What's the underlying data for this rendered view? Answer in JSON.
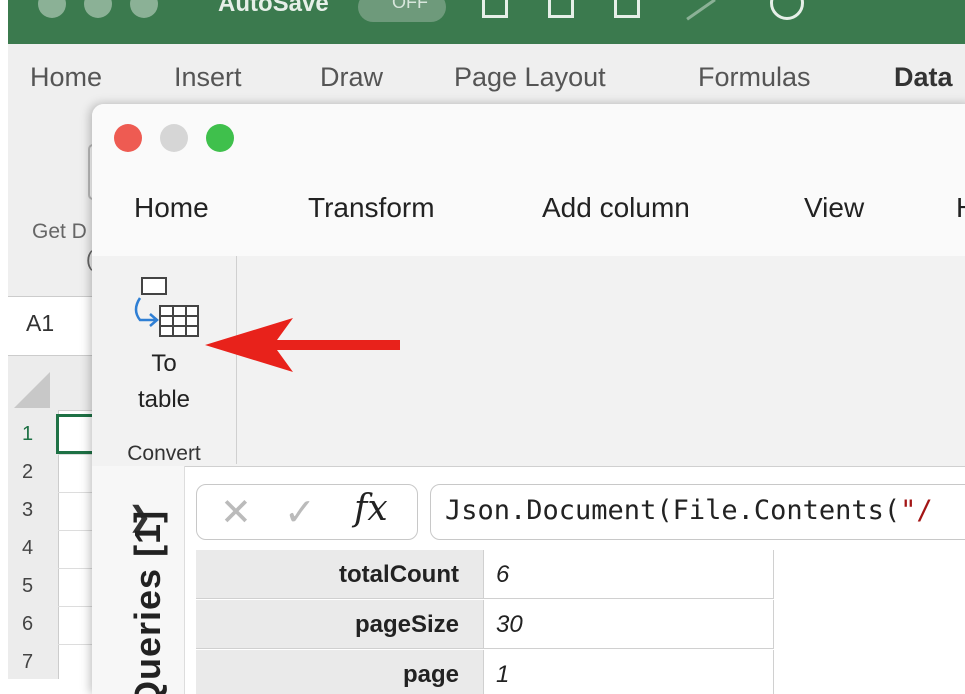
{
  "excel": {
    "title_bar": {
      "autosave_label": "AutoSave",
      "autosave_state": "OFF"
    },
    "tabs": [
      "Home",
      "Insert",
      "Draw",
      "Page Layout",
      "Formulas",
      "Data"
    ],
    "ribbon": {
      "get_data_line1": "Get D",
      "get_data_line2": "("
    },
    "name_box": "A1",
    "row_numbers": [
      "1",
      "2",
      "3",
      "4",
      "5",
      "6",
      "7"
    ],
    "accent_color": "#3b7a4e"
  },
  "power_query": {
    "tabs": [
      "Home",
      "Transform",
      "Add column",
      "View",
      "H"
    ],
    "ribbon": {
      "to_table_line1": "To",
      "to_table_line2": "table",
      "group_label": "Convert",
      "to_table_icon": "to-table-icon"
    },
    "queries_pane": {
      "expand_icon": "chevron-right-icon",
      "label": "Queries [1]"
    },
    "formula_bar": {
      "cancel_icon": "cross-icon",
      "commit_icon": "check-icon",
      "fx_label": "fx",
      "formula_prefix": "Json.Document(File.Contents(",
      "formula_string": "\"/"
    },
    "record": [
      {
        "key": "totalCount",
        "value": "6"
      },
      {
        "key": "pageSize",
        "value": "30"
      },
      {
        "key": "page",
        "value": "1"
      }
    ]
  },
  "annotation": {
    "arrow_color": "#e8221b"
  }
}
